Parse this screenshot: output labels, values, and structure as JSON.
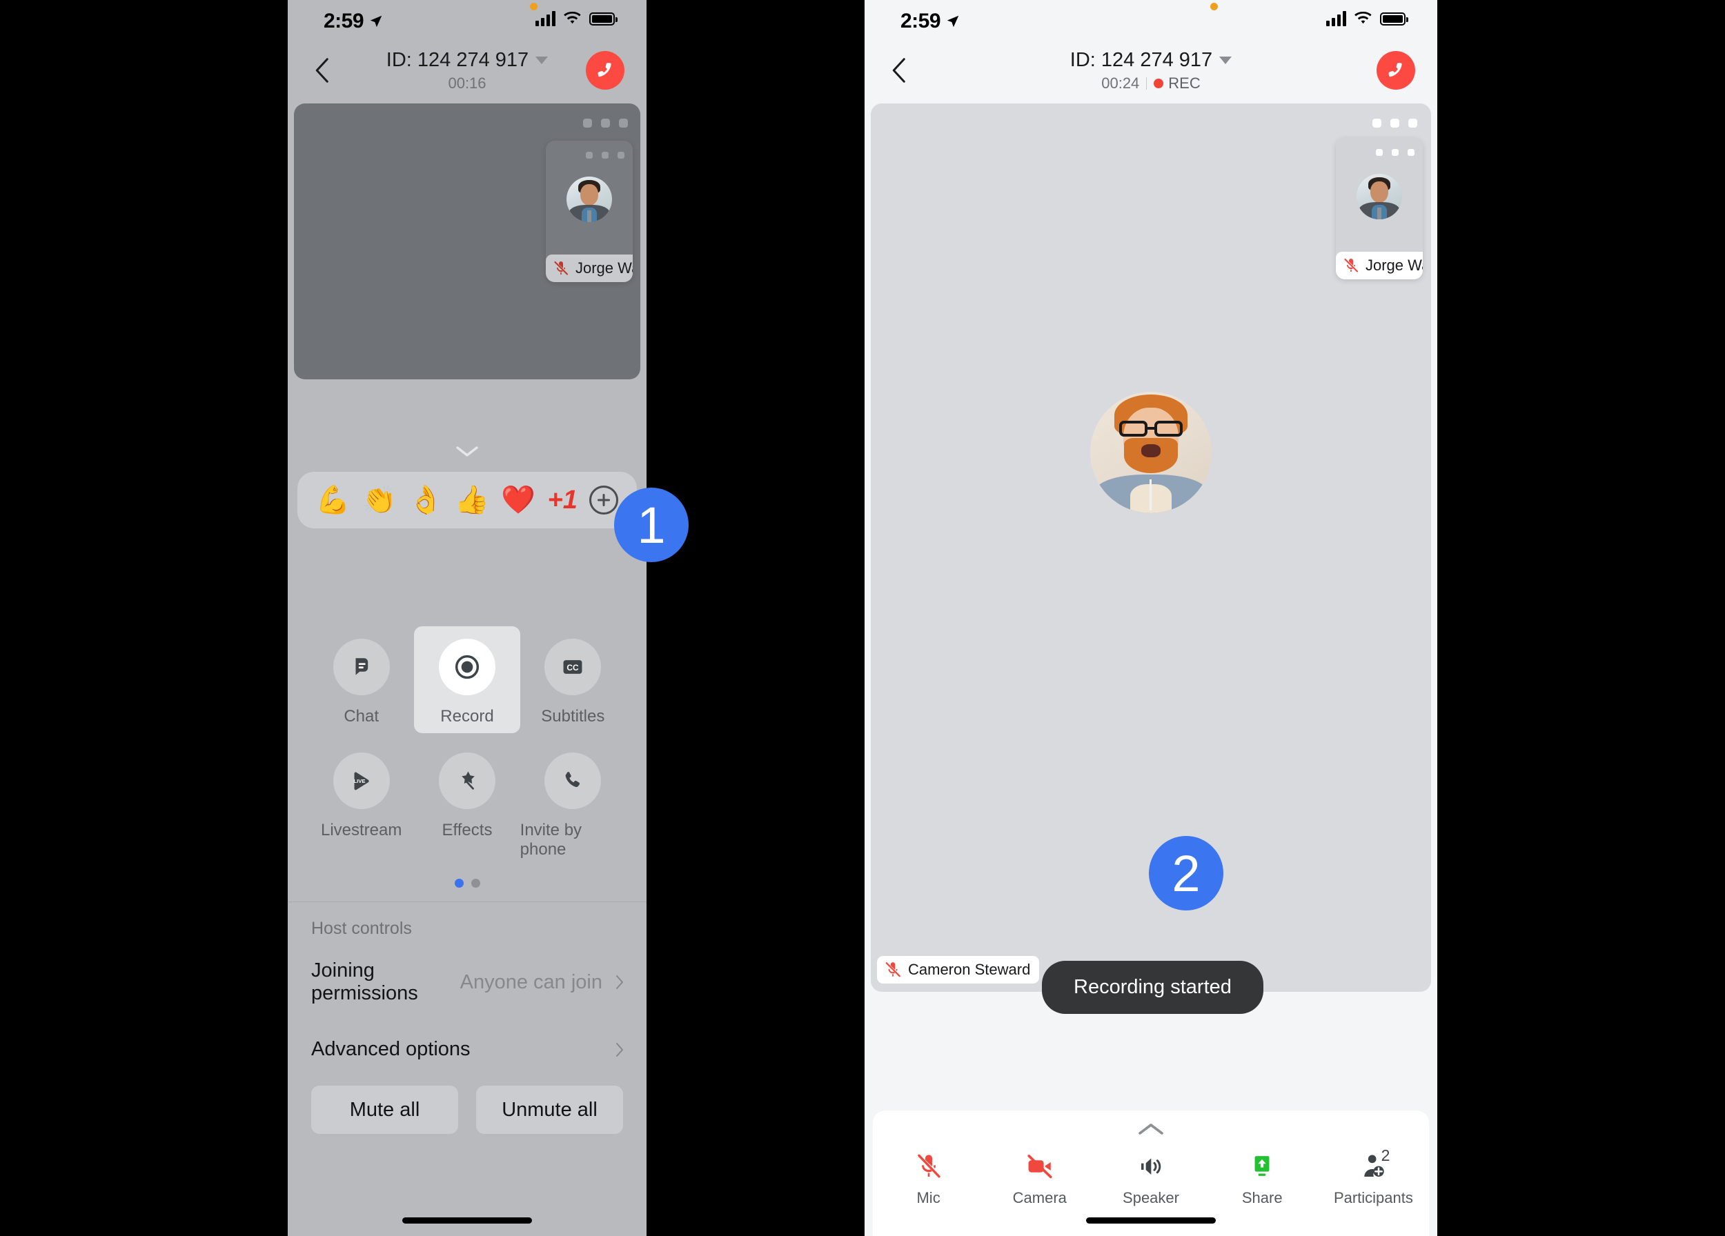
{
  "left_phone": {
    "status_bar": {
      "time": "2:59",
      "location_icon": "location-arrow-icon",
      "signal_icon": "cellular-bars-icon",
      "wifi_icon": "wifi-icon",
      "battery_icon": "battery-icon"
    },
    "nav": {
      "back_icon": "chevron-left-icon",
      "title": "ID: 124 274 917",
      "caret_icon": "chevron-down-icon",
      "duration": "00:16",
      "end_call_icon": "end-call-icon"
    },
    "video": {
      "overflow_icon": "more-options-icon",
      "pip": {
        "name": "Jorge Wa...",
        "mute_icon": "mic-muted-icon",
        "overflow_icon": "more-options-icon"
      }
    },
    "reactions": {
      "collapse_icon": "chevron-down-icon",
      "items": [
        {
          "name": "flexed-biceps-emoji",
          "glyph": "💪"
        },
        {
          "name": "clapping-hands-emoji",
          "glyph": "👏"
        },
        {
          "name": "ok-hand-emoji",
          "glyph": "👌"
        },
        {
          "name": "thumbs-up-emoji",
          "glyph": "👍"
        },
        {
          "name": "red-heart-emoji",
          "glyph": "❤️"
        }
      ],
      "plus_one": "+1",
      "add_label": "add-reaction-icon"
    },
    "actions": [
      {
        "label": "Chat",
        "icon": "chat-bubble-icon",
        "highlighted": false
      },
      {
        "label": "Record",
        "icon": "record-icon",
        "highlighted": true
      },
      {
        "label": "Subtitles",
        "icon": "closed-captions-icon",
        "highlighted": false
      },
      {
        "label": "Livestream",
        "icon": "live-stream-icon",
        "highlighted": false
      },
      {
        "label": "Effects",
        "icon": "magic-wand-icon",
        "highlighted": false
      },
      {
        "label": "Invite by phone",
        "icon": "phone-icon",
        "highlighted": false
      }
    ],
    "pager": {
      "pages": 2,
      "active": 1
    },
    "host_controls": {
      "title": "Host controls",
      "rows": [
        {
          "label": "Joining permissions",
          "value": "Anyone can join",
          "chevron": "chevron-right-icon"
        },
        {
          "label": "Advanced options",
          "value": "",
          "chevron": "chevron-right-icon"
        }
      ],
      "mute_all": "Mute all",
      "unmute_all": "Unmute all"
    }
  },
  "right_phone": {
    "status_bar": {
      "time": "2:59",
      "location_icon": "location-arrow-icon",
      "signal_icon": "cellular-bars-icon",
      "wifi_icon": "wifi-icon",
      "battery_icon": "battery-icon"
    },
    "nav": {
      "back_icon": "chevron-left-icon",
      "title": "ID: 124 274 917",
      "caret_icon": "chevron-down-icon",
      "duration": "00:24",
      "rec_label": "REC",
      "rec_dot": "recording-dot-icon",
      "end_call_icon": "end-call-icon"
    },
    "video": {
      "overflow_icon": "more-options-icon",
      "active_speaker": {
        "name": "Cameron Steward",
        "mute_icon": "mic-muted-icon"
      },
      "pip": {
        "name": "Jorge Wa...",
        "mute_icon": "mic-muted-icon",
        "overflow_icon": "more-options-icon"
      }
    },
    "toast": "Recording started",
    "toolbar": {
      "expand_icon": "chevron-up-icon",
      "items": [
        {
          "label": "Mic",
          "icon": "mic-muted-icon",
          "state": "off"
        },
        {
          "label": "Camera",
          "icon": "camera-off-icon",
          "state": "off"
        },
        {
          "label": "Speaker",
          "icon": "speaker-icon",
          "state": "on"
        },
        {
          "label": "Share",
          "icon": "share-screen-icon",
          "state": "on"
        },
        {
          "label": "Participants",
          "icon": "participants-icon",
          "badge": "2"
        }
      ]
    }
  },
  "annotations": [
    {
      "id": "step-1",
      "number": "1"
    },
    {
      "id": "step-2",
      "number": "2"
    }
  ],
  "colors": {
    "accent_blue": "#3b76f0",
    "danger_red": "#fc4a43",
    "share_green": "#22c132",
    "toast_bg": "#343638"
  }
}
